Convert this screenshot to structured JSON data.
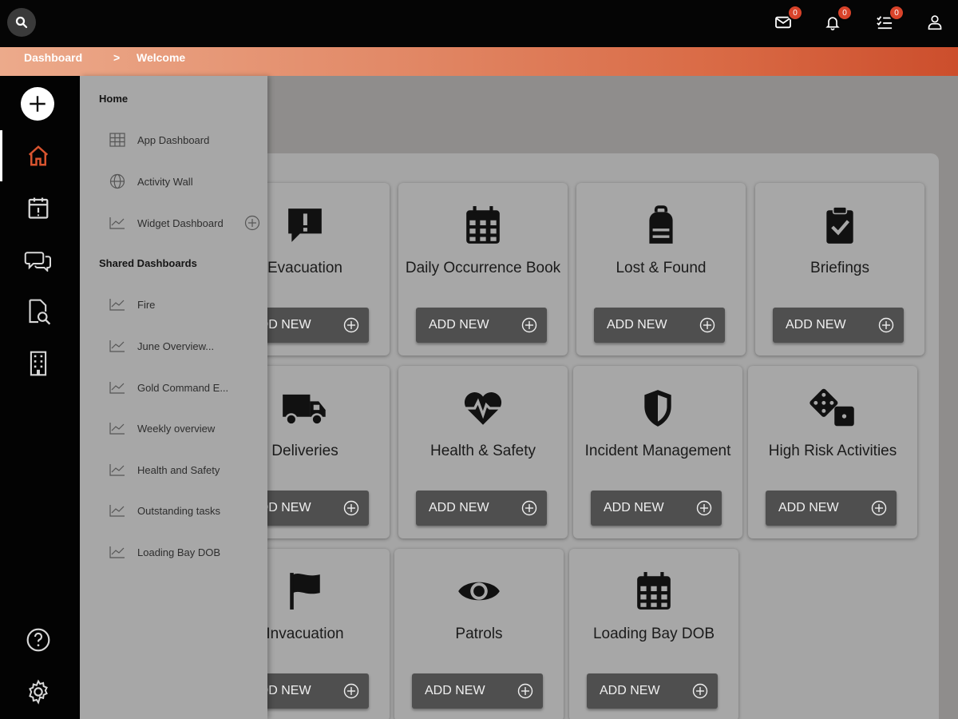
{
  "topbar": {
    "mail_badge": "0",
    "notif_badge": "0",
    "tasks_badge": "0"
  },
  "breadcrumb": {
    "items": [
      "Dashboard",
      "Welcome"
    ],
    "separator": ">"
  },
  "drawer": {
    "home_heading": "Home",
    "home_items": [
      {
        "label": "App Dashboard",
        "icon": "grid-icon"
      },
      {
        "label": "Activity Wall",
        "icon": "globe-icon"
      },
      {
        "label": "Widget Dashboard",
        "icon": "chart-icon"
      }
    ],
    "shared_heading": "Shared Dashboards",
    "shared_items": [
      {
        "label": "Fire"
      },
      {
        "label": "June Overview..."
      },
      {
        "label": "Gold Command E..."
      },
      {
        "label": "Weekly overview"
      },
      {
        "label": "Health and Safety"
      },
      {
        "label": "Outstanding tasks"
      },
      {
        "label": "Loading Bay DOB"
      }
    ]
  },
  "cards": [
    {
      "title": "Evacuation",
      "icon": "alert-message-icon",
      "button": "ADD NEW"
    },
    {
      "title": "Daily Occurrence Book",
      "icon": "calendar-icon",
      "button": "ADD NEW"
    },
    {
      "title": "Lost & Found",
      "icon": "backpack-icon",
      "button": "ADD NEW"
    },
    {
      "title": "Briefings",
      "icon": "clipboard-check-icon",
      "button": "ADD NEW"
    },
    {
      "title": "Deliveries",
      "icon": "truck-icon",
      "button": "ADD NEW"
    },
    {
      "title": "Health & Safety",
      "icon": "heartbeat-icon",
      "button": "ADD NEW"
    },
    {
      "title": "Incident Management",
      "icon": "shield-icon",
      "button": "ADD NEW"
    },
    {
      "title": "High Risk Activities",
      "icon": "dice-icon",
      "button": "ADD NEW"
    },
    {
      "title": "Invacuation",
      "icon": "flag-icon",
      "button": "ADD NEW"
    },
    {
      "title": "Patrols",
      "icon": "eye-icon",
      "button": "ADD NEW"
    },
    {
      "title": "Loading Bay DOB",
      "icon": "calendar-icon",
      "button": "ADD NEW"
    }
  ],
  "colors": {
    "accent": "#d9542f",
    "topbar": "#050505",
    "rail": "#030303"
  }
}
